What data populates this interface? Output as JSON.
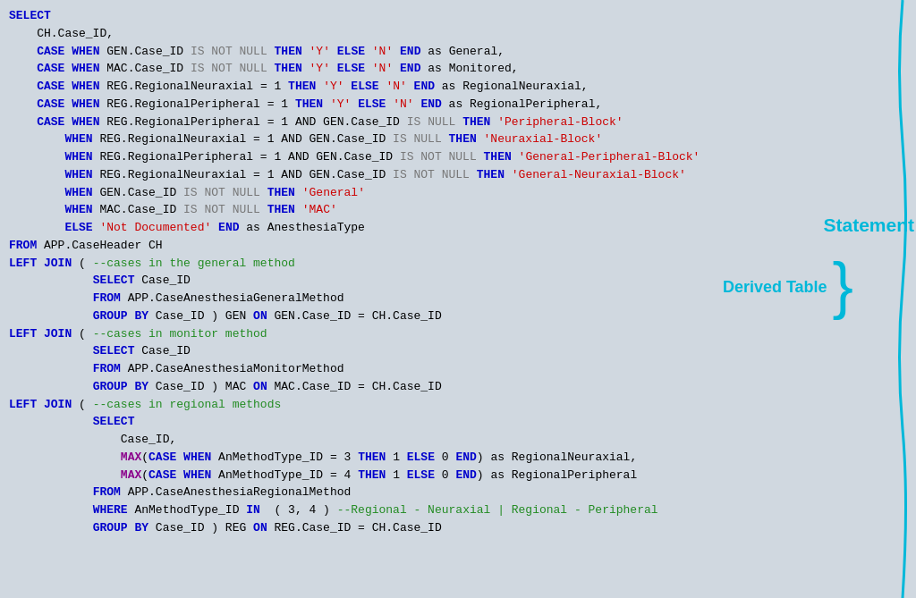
{
  "code": {
    "lines": [
      {
        "id": "l1",
        "parts": [
          {
            "text": "SELECT",
            "style": "kw-blue"
          }
        ]
      },
      {
        "id": "l2",
        "parts": [
          {
            "text": "    CH.Case_ID,",
            "style": "normal"
          }
        ]
      },
      {
        "id": "l3",
        "parts": [
          {
            "text": "    ",
            "style": "normal"
          },
          {
            "text": "CASE",
            "style": "kw-blue"
          },
          {
            "text": " ",
            "style": "normal"
          },
          {
            "text": "WHEN",
            "style": "kw-blue"
          },
          {
            "text": " GEN.Case_ID ",
            "style": "normal"
          },
          {
            "text": "IS NOT NULL",
            "style": "faded"
          },
          {
            "text": " ",
            "style": "normal"
          },
          {
            "text": "THEN",
            "style": "kw-blue"
          },
          {
            "text": " ",
            "style": "normal"
          },
          {
            "text": "'Y'",
            "style": "str-red"
          },
          {
            "text": " ",
            "style": "normal"
          },
          {
            "text": "ELSE",
            "style": "kw-blue"
          },
          {
            "text": " ",
            "style": "normal"
          },
          {
            "text": "'N'",
            "style": "str-red"
          },
          {
            "text": " ",
            "style": "normal"
          },
          {
            "text": "END",
            "style": "kw-blue"
          },
          {
            "text": " as General,",
            "style": "normal"
          }
        ]
      },
      {
        "id": "l4",
        "parts": [
          {
            "text": "    ",
            "style": "normal"
          },
          {
            "text": "CASE",
            "style": "kw-blue"
          },
          {
            "text": " ",
            "style": "normal"
          },
          {
            "text": "WHEN",
            "style": "kw-blue"
          },
          {
            "text": " MAC.Case_ID ",
            "style": "normal"
          },
          {
            "text": "IS NOT NULL",
            "style": "faded"
          },
          {
            "text": " ",
            "style": "normal"
          },
          {
            "text": "THEN",
            "style": "kw-blue"
          },
          {
            "text": " ",
            "style": "normal"
          },
          {
            "text": "'Y'",
            "style": "str-red"
          },
          {
            "text": " ",
            "style": "normal"
          },
          {
            "text": "ELSE",
            "style": "kw-blue"
          },
          {
            "text": " ",
            "style": "normal"
          },
          {
            "text": "'N'",
            "style": "str-red"
          },
          {
            "text": " ",
            "style": "normal"
          },
          {
            "text": "END",
            "style": "kw-blue"
          },
          {
            "text": " as Monitored,",
            "style": "normal"
          }
        ]
      },
      {
        "id": "l5",
        "parts": [
          {
            "text": "    ",
            "style": "normal"
          },
          {
            "text": "CASE",
            "style": "kw-blue"
          },
          {
            "text": " ",
            "style": "normal"
          },
          {
            "text": "WHEN",
            "style": "kw-blue"
          },
          {
            "text": " REG.RegionalNeuraxial = 1 ",
            "style": "normal"
          },
          {
            "text": "THEN",
            "style": "kw-blue"
          },
          {
            "text": " ",
            "style": "normal"
          },
          {
            "text": "'Y'",
            "style": "str-red"
          },
          {
            "text": " ",
            "style": "normal"
          },
          {
            "text": "ELSE",
            "style": "kw-blue"
          },
          {
            "text": " ",
            "style": "normal"
          },
          {
            "text": "'N'",
            "style": "str-red"
          },
          {
            "text": " ",
            "style": "normal"
          },
          {
            "text": "END",
            "style": "kw-blue"
          },
          {
            "text": " as RegionalNeuraxial,",
            "style": "normal"
          }
        ]
      },
      {
        "id": "l6",
        "parts": [
          {
            "text": "    ",
            "style": "normal"
          },
          {
            "text": "CASE",
            "style": "kw-blue"
          },
          {
            "text": " ",
            "style": "normal"
          },
          {
            "text": "WHEN",
            "style": "kw-blue"
          },
          {
            "text": " REG.RegionalPeripheral = 1 ",
            "style": "normal"
          },
          {
            "text": "THEN",
            "style": "kw-blue"
          },
          {
            "text": " ",
            "style": "normal"
          },
          {
            "text": "'Y'",
            "style": "str-red"
          },
          {
            "text": " ",
            "style": "normal"
          },
          {
            "text": "ELSE",
            "style": "kw-blue"
          },
          {
            "text": " ",
            "style": "normal"
          },
          {
            "text": "'N'",
            "style": "str-red"
          },
          {
            "text": " ",
            "style": "normal"
          },
          {
            "text": "END",
            "style": "kw-blue"
          },
          {
            "text": " as RegionalPeripheral,",
            "style": "normal"
          }
        ]
      },
      {
        "id": "l7",
        "parts": [
          {
            "text": "    ",
            "style": "normal"
          },
          {
            "text": "CASE",
            "style": "kw-blue"
          },
          {
            "text": " ",
            "style": "normal"
          },
          {
            "text": "WHEN",
            "style": "kw-blue"
          },
          {
            "text": " REG.RegionalPeripheral = 1 AND GEN.Case_ID ",
            "style": "normal"
          },
          {
            "text": "IS NULL",
            "style": "faded"
          },
          {
            "text": " ",
            "style": "normal"
          },
          {
            "text": "THEN",
            "style": "kw-blue"
          },
          {
            "text": " ",
            "style": "normal"
          },
          {
            "text": "'Peripheral-Block'",
            "style": "str-red"
          }
        ]
      },
      {
        "id": "l8",
        "parts": [
          {
            "text": "        ",
            "style": "normal"
          },
          {
            "text": "WHEN",
            "style": "kw-blue"
          },
          {
            "text": " REG.RegionalNeuraxial = 1 AND GEN.Case_ID ",
            "style": "normal"
          },
          {
            "text": "IS NULL",
            "style": "faded"
          },
          {
            "text": " ",
            "style": "normal"
          },
          {
            "text": "THEN",
            "style": "kw-blue"
          },
          {
            "text": " ",
            "style": "normal"
          },
          {
            "text": "'Neuraxial-Block'",
            "style": "str-red"
          }
        ]
      },
      {
        "id": "l9",
        "parts": [
          {
            "text": "        ",
            "style": "normal"
          },
          {
            "text": "WHEN",
            "style": "kw-blue"
          },
          {
            "text": " REG.RegionalPeripheral = 1 AND GEN.Case_ID ",
            "style": "normal"
          },
          {
            "text": "IS NOT NULL",
            "style": "faded"
          },
          {
            "text": " ",
            "style": "normal"
          },
          {
            "text": "THEN",
            "style": "kw-blue"
          },
          {
            "text": " ",
            "style": "normal"
          },
          {
            "text": "'General-Peripheral-Block'",
            "style": "str-red"
          }
        ]
      },
      {
        "id": "l10",
        "parts": [
          {
            "text": "        ",
            "style": "normal"
          },
          {
            "text": "WHEN",
            "style": "kw-blue"
          },
          {
            "text": " REG.RegionalNeuraxial = 1 AND GEN.Case_ID ",
            "style": "normal"
          },
          {
            "text": "IS NOT NULL",
            "style": "faded"
          },
          {
            "text": " ",
            "style": "normal"
          },
          {
            "text": "THEN",
            "style": "kw-blue"
          },
          {
            "text": " ",
            "style": "normal"
          },
          {
            "text": "'General-Neuraxial-Block'",
            "style": "str-red"
          }
        ]
      },
      {
        "id": "l11",
        "parts": [
          {
            "text": "        ",
            "style": "normal"
          },
          {
            "text": "WHEN",
            "style": "kw-blue"
          },
          {
            "text": " GEN.Case_ID ",
            "style": "normal"
          },
          {
            "text": "IS NOT NULL",
            "style": "faded"
          },
          {
            "text": " ",
            "style": "normal"
          },
          {
            "text": "THEN",
            "style": "kw-blue"
          },
          {
            "text": " ",
            "style": "normal"
          },
          {
            "text": "'General'",
            "style": "str-red"
          }
        ]
      },
      {
        "id": "l12",
        "parts": [
          {
            "text": "        ",
            "style": "normal"
          },
          {
            "text": "WHEN",
            "style": "kw-blue"
          },
          {
            "text": " MAC.Case_ID ",
            "style": "normal"
          },
          {
            "text": "IS NOT NULL",
            "style": "faded"
          },
          {
            "text": " ",
            "style": "normal"
          },
          {
            "text": "THEN",
            "style": "kw-blue"
          },
          {
            "text": " ",
            "style": "normal"
          },
          {
            "text": "'MAC'",
            "style": "str-red"
          }
        ]
      },
      {
        "id": "l13",
        "parts": [
          {
            "text": "        ",
            "style": "normal"
          },
          {
            "text": "ELSE",
            "style": "kw-blue"
          },
          {
            "text": " ",
            "style": "normal"
          },
          {
            "text": "'Not Documented'",
            "style": "str-red"
          },
          {
            "text": " ",
            "style": "normal"
          },
          {
            "text": "END",
            "style": "kw-blue"
          },
          {
            "text": " as AnesthesiaType",
            "style": "normal"
          }
        ]
      },
      {
        "id": "l14",
        "parts": [
          {
            "text": "FROM",
            "style": "kw-blue"
          },
          {
            "text": " APP.CaseHeader CH",
            "style": "normal"
          }
        ]
      },
      {
        "id": "l15",
        "parts": [
          {
            "text": "LEFT JOIN",
            "style": "kw-blue"
          },
          {
            "text": " ( ",
            "style": "normal"
          },
          {
            "text": "--cases in the general method",
            "style": "comment-green"
          }
        ]
      },
      {
        "id": "l16",
        "parts": [
          {
            "text": "            ",
            "style": "normal"
          },
          {
            "text": "SELECT",
            "style": "kw-blue"
          },
          {
            "text": " Case_ID",
            "style": "normal"
          }
        ]
      },
      {
        "id": "l17",
        "parts": [
          {
            "text": "            ",
            "style": "normal"
          },
          {
            "text": "FROM",
            "style": "kw-blue"
          },
          {
            "text": " APP.CaseAnesthesiaGeneralMethod",
            "style": "normal"
          }
        ]
      },
      {
        "id": "l18",
        "parts": [
          {
            "text": "            ",
            "style": "normal"
          },
          {
            "text": "GROUP BY",
            "style": "kw-blue"
          },
          {
            "text": " Case_ID ) GEN ",
            "style": "normal"
          },
          {
            "text": "ON",
            "style": "kw-blue"
          },
          {
            "text": " GEN.Case_ID = CH.Case_ID",
            "style": "normal"
          }
        ]
      },
      {
        "id": "l19",
        "parts": [
          {
            "text": "LEFT JOIN",
            "style": "kw-blue"
          },
          {
            "text": " ( ",
            "style": "normal"
          },
          {
            "text": "--cases in monitor method",
            "style": "comment-green"
          }
        ]
      },
      {
        "id": "l20",
        "parts": [
          {
            "text": "            ",
            "style": "normal"
          },
          {
            "text": "SELECT",
            "style": "kw-blue"
          },
          {
            "text": " Case_ID",
            "style": "normal"
          }
        ]
      },
      {
        "id": "l21",
        "parts": [
          {
            "text": "            ",
            "style": "normal"
          },
          {
            "text": "FROM",
            "style": "kw-blue"
          },
          {
            "text": " APP.CaseAnesthesiaMonitorMethod",
            "style": "normal"
          }
        ]
      },
      {
        "id": "l22",
        "parts": [
          {
            "text": "            ",
            "style": "normal"
          },
          {
            "text": "GROUP BY",
            "style": "kw-blue"
          },
          {
            "text": " Case_ID ) MAC ",
            "style": "normal"
          },
          {
            "text": "ON",
            "style": "kw-blue"
          },
          {
            "text": " MAC.Case_ID = CH.Case_ID",
            "style": "normal"
          }
        ]
      },
      {
        "id": "l23",
        "parts": [
          {
            "text": "LEFT JOIN",
            "style": "kw-blue"
          },
          {
            "text": " ( ",
            "style": "normal"
          },
          {
            "text": "--cases in regional methods",
            "style": "comment-green"
          }
        ]
      },
      {
        "id": "l24",
        "parts": [
          {
            "text": "            ",
            "style": "normal"
          },
          {
            "text": "SELECT",
            "style": "kw-blue"
          }
        ]
      },
      {
        "id": "l25",
        "parts": [
          {
            "text": "                Case_ID,",
            "style": "normal"
          }
        ]
      },
      {
        "id": "l26",
        "parts": [
          {
            "text": "                ",
            "style": "normal"
          },
          {
            "text": "MAX",
            "style": "kw-purple"
          },
          {
            "text": "(",
            "style": "normal"
          },
          {
            "text": "CASE",
            "style": "kw-blue"
          },
          {
            "text": " ",
            "style": "normal"
          },
          {
            "text": "WHEN",
            "style": "kw-blue"
          },
          {
            "text": " AnMethodType_ID = 3 ",
            "style": "normal"
          },
          {
            "text": "THEN",
            "style": "kw-blue"
          },
          {
            "text": " 1 ",
            "style": "normal"
          },
          {
            "text": "ELSE",
            "style": "kw-blue"
          },
          {
            "text": " 0 ",
            "style": "normal"
          },
          {
            "text": "END",
            "style": "kw-blue"
          },
          {
            "text": ") as RegionalNeuraxial,",
            "style": "normal"
          }
        ]
      },
      {
        "id": "l27",
        "parts": [
          {
            "text": "                ",
            "style": "normal"
          },
          {
            "text": "MAX",
            "style": "kw-purple"
          },
          {
            "text": "(",
            "style": "normal"
          },
          {
            "text": "CASE",
            "style": "kw-blue"
          },
          {
            "text": " ",
            "style": "normal"
          },
          {
            "text": "WHEN",
            "style": "kw-blue"
          },
          {
            "text": " AnMethodType_ID = 4 ",
            "style": "normal"
          },
          {
            "text": "THEN",
            "style": "kw-blue"
          },
          {
            "text": " 1 ",
            "style": "normal"
          },
          {
            "text": "ELSE",
            "style": "kw-blue"
          },
          {
            "text": " 0 ",
            "style": "normal"
          },
          {
            "text": "END",
            "style": "kw-blue"
          },
          {
            "text": ") as RegionalPeripheral",
            "style": "normal"
          }
        ]
      },
      {
        "id": "l28",
        "parts": [
          {
            "text": "            ",
            "style": "normal"
          },
          {
            "text": "FROM",
            "style": "kw-blue"
          },
          {
            "text": " APP.CaseAnesthesiaRegionalMethod",
            "style": "normal"
          }
        ]
      },
      {
        "id": "l29",
        "parts": [
          {
            "text": "            ",
            "style": "normal"
          },
          {
            "text": "WHERE",
            "style": "kw-blue"
          },
          {
            "text": " AnMethodType_ID ",
            "style": "normal"
          },
          {
            "text": "IN",
            "style": "kw-blue"
          },
          {
            "text": "  ( 3, 4 ) ",
            "style": "normal"
          },
          {
            "text": "--Regional - Neuraxial | Regional - Peripheral",
            "style": "comment-green"
          }
        ]
      },
      {
        "id": "l30",
        "parts": [
          {
            "text": "            ",
            "style": "normal"
          },
          {
            "text": "GROUP BY",
            "style": "kw-blue"
          },
          {
            "text": " Case_ID ) REG ",
            "style": "normal"
          },
          {
            "text": "ON",
            "style": "kw-blue"
          },
          {
            "text": " REG.Case_ID = CH.Case_ID",
            "style": "normal"
          }
        ]
      }
    ]
  },
  "annotations": {
    "statement_label": "Statement",
    "derived_table_label": "Derived Table"
  }
}
